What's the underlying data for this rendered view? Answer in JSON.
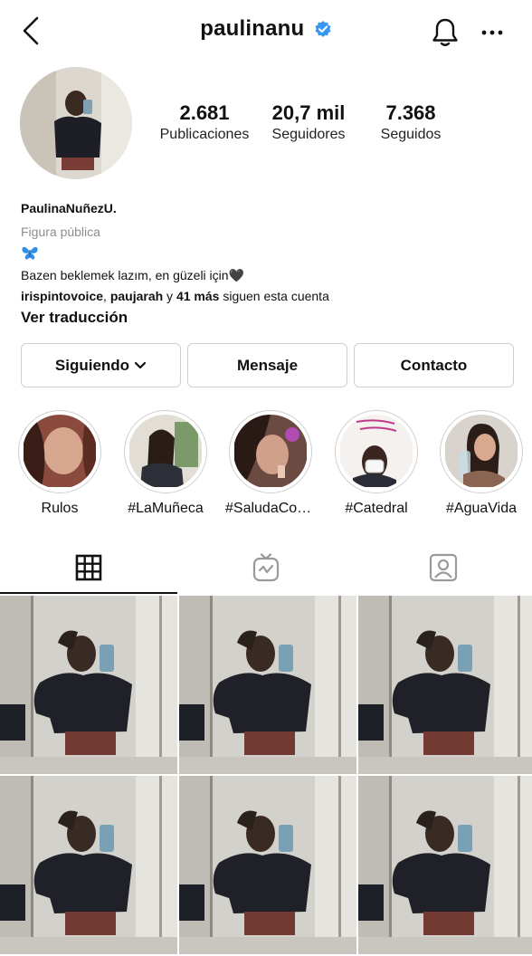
{
  "header": {
    "username": "paulinanu",
    "back_icon": "chevron-left-icon",
    "notification_icon": "bell-icon",
    "more_icon": "more-horizontal-icon",
    "verified_color": "#3897f0"
  },
  "profile": {
    "stats": [
      {
        "value": "2.681",
        "label": "Publicaciones"
      },
      {
        "value": "20,7 mil",
        "label": "Seguidores"
      },
      {
        "value": "7.368",
        "label": "Seguidos"
      }
    ],
    "display_name": "PaulinaNuñezU.",
    "category": "Figura pública",
    "bio_emoji": "🦋",
    "bio_text": "Bazen beklemek lazım, en güzeli için🖤",
    "followed_by": {
      "user1": "irispintovoice",
      "sep": ", ",
      "user2": "paujarah",
      "and": " y ",
      "count": "41 más",
      "suffix": " siguen esta cuenta"
    },
    "translate_label": "Ver traducción"
  },
  "actions": {
    "following_label": "Siguiendo",
    "message_label": "Mensaje",
    "contact_label": "Contacto"
  },
  "highlights": [
    {
      "label": "Rulos"
    },
    {
      "label": "#LaMuñeca"
    },
    {
      "label": "#SaludaCon..."
    },
    {
      "label": "#Catedral"
    },
    {
      "label": "#AguaVida"
    }
  ],
  "tabs": [
    {
      "icon": "grid-icon",
      "active": true
    },
    {
      "icon": "igtv-icon",
      "active": false
    },
    {
      "icon": "tagged-icon",
      "active": false
    }
  ]
}
